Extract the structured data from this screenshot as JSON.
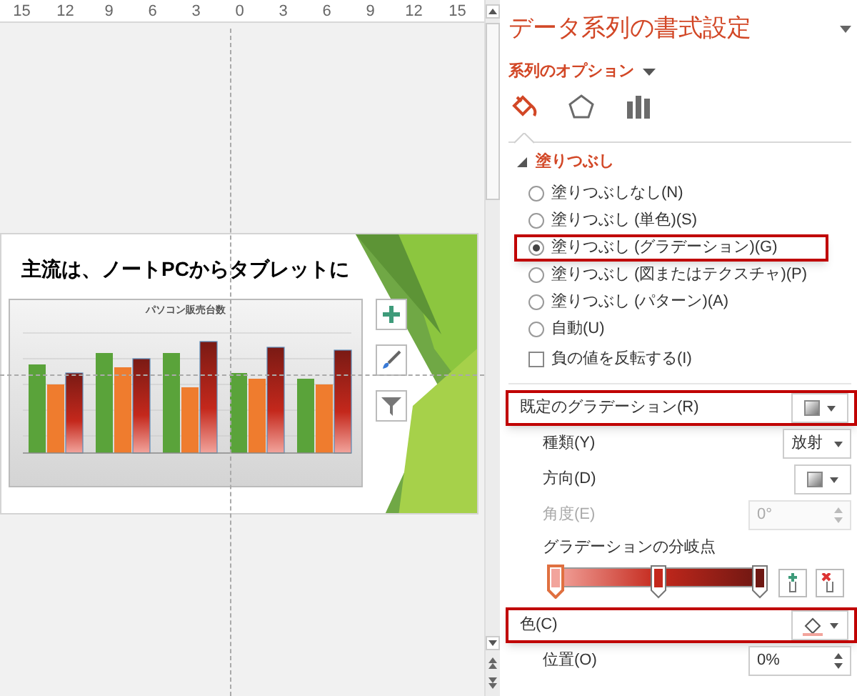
{
  "ruler": {
    "ticks": [
      "15",
      "12",
      "9",
      "6",
      "3",
      "0",
      "3",
      "6",
      "9",
      "12",
      "15"
    ]
  },
  "slide": {
    "title": "主流は、ノートPCからタブレットに",
    "chart_title": "パソコン販売台数"
  },
  "pane": {
    "title": "データ系列の書式設定",
    "options_menu": "系列のオプション",
    "icon_tabs": [
      {
        "kind": "fill",
        "selected": true
      },
      {
        "kind": "effects",
        "selected": false
      },
      {
        "kind": "series",
        "selected": false
      }
    ],
    "section": {
      "title": "塗りつぶし",
      "expanded": true
    },
    "fill_options": [
      {
        "label": "塗りつぶしなし(N)",
        "selected": false,
        "highlighted": false
      },
      {
        "label": "塗りつぶし (単色)(S)",
        "selected": false,
        "highlighted": false
      },
      {
        "label": "塗りつぶし (グラデーション)(G)",
        "selected": true,
        "highlighted": true
      },
      {
        "label": "塗りつぶし (図またはテクスチャ)(P)",
        "selected": false,
        "highlighted": false
      },
      {
        "label": "塗りつぶし (パターン)(A)",
        "selected": false,
        "highlighted": false
      },
      {
        "label": "自動(U)",
        "selected": false,
        "highlighted": false
      }
    ],
    "invert": {
      "label": "負の値を反転する(I)",
      "checked": false
    },
    "properties": [
      {
        "kind": "preset",
        "label": "既定のグラデーション(R)",
        "highlighted": true,
        "disabled": false
      },
      {
        "kind": "select",
        "label": "種類(Y)",
        "value": "放射",
        "highlighted": false,
        "disabled": false
      },
      {
        "kind": "preset",
        "label": "方向(D)",
        "highlighted": false,
        "disabled": false
      },
      {
        "kind": "spin",
        "label": "角度(E)",
        "value": "0°",
        "highlighted": false,
        "disabled": true
      }
    ],
    "stops_label": "グラデーションの分岐点",
    "stops": [
      {
        "level": 0,
        "color": "#f2a49c",
        "selected": true
      },
      {
        "level": 0.5,
        "color": "#c4281c",
        "selected": false
      },
      {
        "level": 1,
        "color": "#6e1712",
        "selected": false
      }
    ],
    "stop_properties": [
      {
        "kind": "color",
        "label": "色(C)",
        "highlighted": true,
        "disabled": false
      },
      {
        "kind": "spin",
        "label": "位置(O)",
        "value": "0%",
        "highlighted": false,
        "disabled": false
      }
    ]
  }
}
